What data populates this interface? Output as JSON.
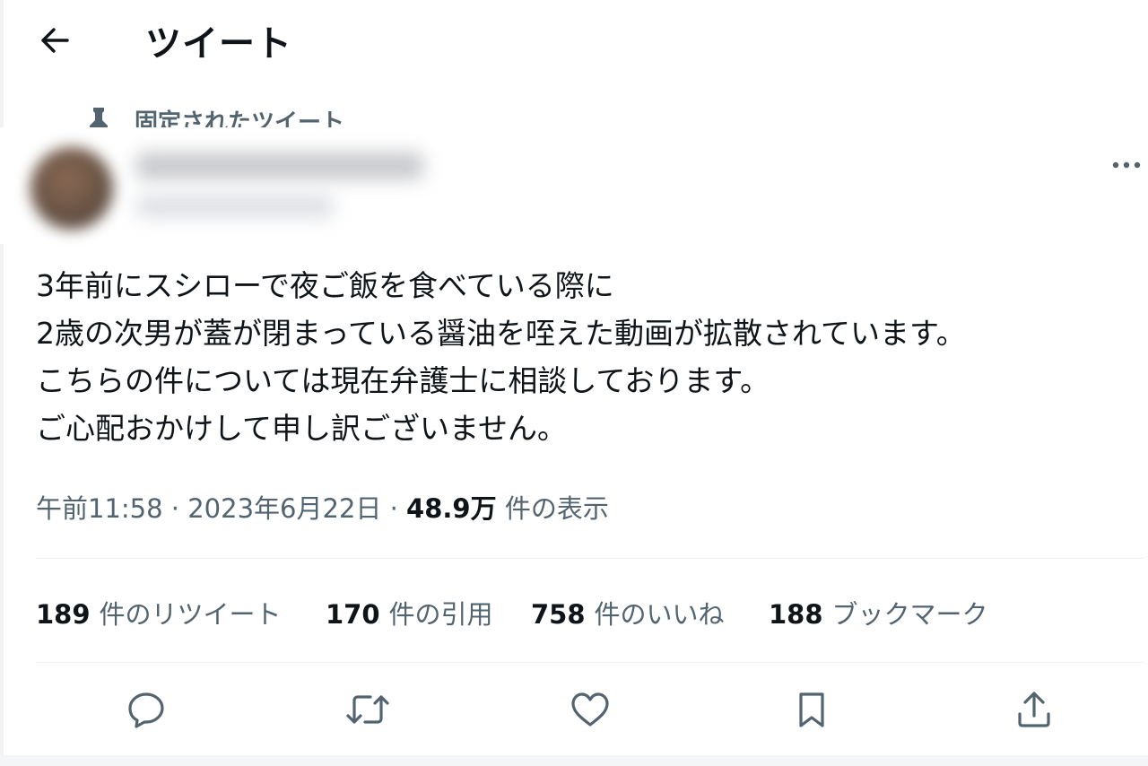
{
  "header": {
    "title": "ツイート",
    "back_icon": "arrow-left-icon"
  },
  "pinned": {
    "label": "固定されたツイート",
    "icon": "pin-icon"
  },
  "tweet": {
    "lines": [
      "3年前にスシローで夜ご飯を食べている際に",
      "2歳の次男が蓋が閉まっている醤油を咥えた動画が拡散されています。",
      "こちらの件については現在弁護士に相談しております。",
      "ご心配おかけして申し訳ございません。"
    ],
    "time": "午前11:58",
    "separator": "·",
    "date": "2023年6月22日",
    "views_count": "48.9万",
    "views_label": "件の表示"
  },
  "stats": [
    {
      "count": "189",
      "label": "件のリツイート"
    },
    {
      "count": "170",
      "label": "件の引用"
    },
    {
      "count": "758",
      "label": "件のいいね"
    },
    {
      "count": "188",
      "label": "ブックマーク"
    }
  ],
  "actions": [
    "reply-icon",
    "retweet-icon",
    "like-icon",
    "bookmark-icon",
    "share-icon"
  ],
  "colors": {
    "text": "#0f1419",
    "secondary": "#536471",
    "divider": "#eff3f4"
  }
}
